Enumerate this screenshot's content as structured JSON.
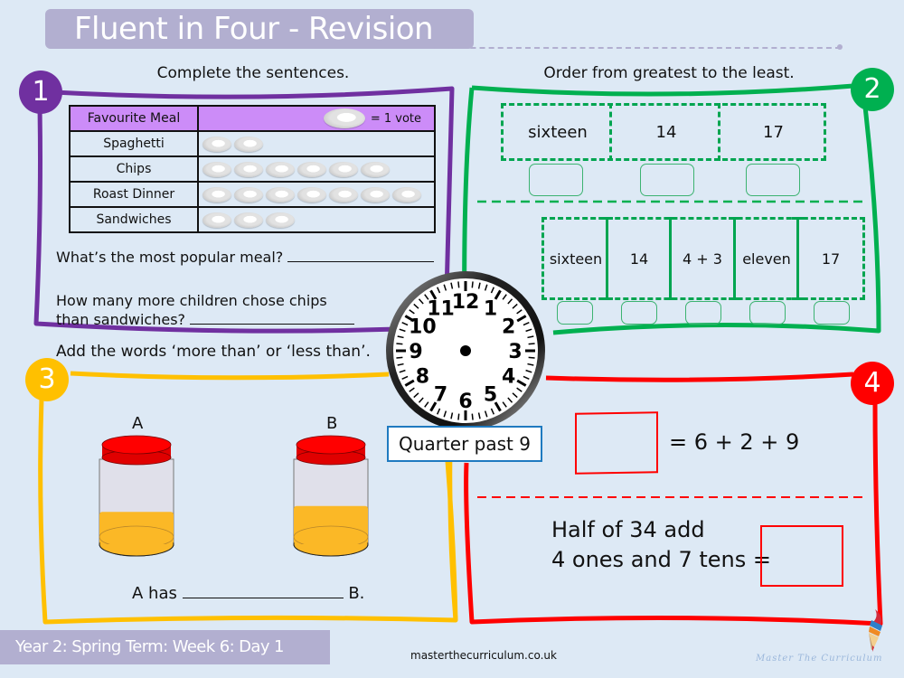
{
  "header": {
    "title": "Fluent in Four - Revision"
  },
  "colors": {
    "q1": "#7030a0",
    "q2": "#00b050",
    "q3": "#ffc000",
    "q4": "#ff0000",
    "banner": "#b2afd0",
    "table_header": "#cc8cf8"
  },
  "q1": {
    "badge": "1",
    "heading": "Complete the sentences.",
    "table": {
      "header_label": "Favourite Meal",
      "key_text": "= 1 vote",
      "key_icon": "plate-icon",
      "rows": [
        {
          "label": "Spaghetti",
          "votes": 2
        },
        {
          "label": "Chips",
          "votes": 6
        },
        {
          "label": "Roast Dinner",
          "votes": 7
        },
        {
          "label": "Sandwiches",
          "votes": 3
        }
      ]
    },
    "question1": "What’s the most popular meal?",
    "question2_line1": "How many more children chose chips",
    "question2_line2": "than sandwiches?"
  },
  "q2": {
    "badge": "2",
    "heading": "Order from greatest to the least.",
    "set1": [
      "sixteen",
      "14",
      "17"
    ],
    "set2": [
      "sixteen",
      "14",
      "4 + 3",
      "eleven",
      "17"
    ]
  },
  "clock": {
    "numbers": [
      "12",
      "1",
      "2",
      "3",
      "4",
      "5",
      "6",
      "7",
      "8",
      "9",
      "10",
      "11"
    ],
    "label": "Quarter past 9"
  },
  "q3": {
    "badge": "3",
    "heading": "Add the words ‘more than’ or ‘less than’.",
    "jar_a_label": "A",
    "jar_b_label": "B",
    "jar_a_fill": 0.38,
    "jar_b_fill": 0.45,
    "sentence_start": "A has",
    "sentence_end": "B."
  },
  "q4": {
    "badge": "4",
    "equation1": "= 6 + 2 + 9",
    "equation2_line1": "Half of 34 add",
    "equation2_line2": "4 ones and 7 tens ="
  },
  "footer": {
    "lesson": "Year 2: Spring Term: Week 6: Day 1",
    "url": "masterthecurriculum.co.uk",
    "brand": "Master  The  Curriculum"
  }
}
